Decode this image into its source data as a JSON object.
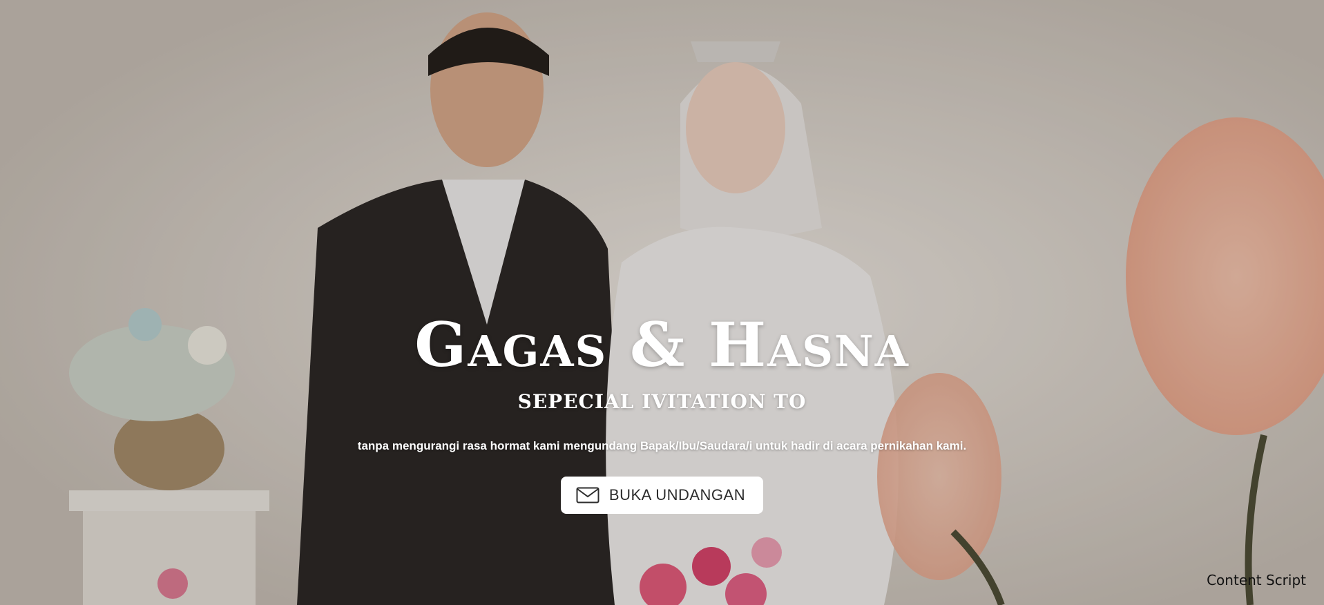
{
  "hero": {
    "title": "Gagas & Hasna",
    "subtitle": "SEPECIAL IVITATION TO",
    "message": "tanpa mengurangi rasa hormat kami mengundang Bapak/Ibu/Saudara/i untuk hadir di acara pernikahan kami.",
    "open_button_label": "BUKA UNDANGAN",
    "open_button_icon": "envelope-icon"
  },
  "footer": {
    "content_script_label": "Content Script"
  },
  "colors": {
    "title_text": "#ffffff",
    "button_bg": "#ffffff",
    "button_text": "#2c2c2c"
  }
}
